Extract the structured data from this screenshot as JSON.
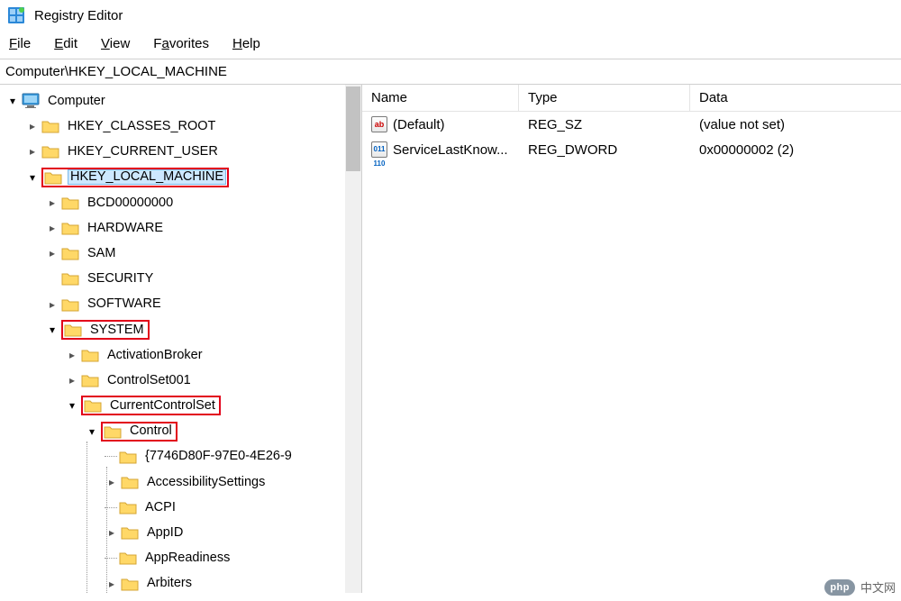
{
  "app": {
    "title": "Registry Editor"
  },
  "menu": {
    "file": "File",
    "edit": "Edit",
    "view": "View",
    "favorites": "Favorites",
    "help": "Help"
  },
  "address": {
    "path": "Computer\\HKEY_LOCAL_MACHINE"
  },
  "tree": {
    "root": "Computer",
    "hkcr": "HKEY_CLASSES_ROOT",
    "hkcu": "HKEY_CURRENT_USER",
    "hklm": "HKEY_LOCAL_MACHINE",
    "bcd": "BCD00000000",
    "hardware": "HARDWARE",
    "sam": "SAM",
    "security": "SECURITY",
    "software": "SOFTWARE",
    "system": "SYSTEM",
    "activationbroker": "ActivationBroker",
    "controlset001": "ControlSet001",
    "currentcontrolset": "CurrentControlSet",
    "control": "Control",
    "guid": "{7746D80F-97E0-4E26-9",
    "accessibility": "AccessibilitySettings",
    "acpi": "ACPI",
    "appid": "AppID",
    "appreadiness": "AppReadiness",
    "arbiters": "Arbiters"
  },
  "columns": {
    "name": "Name",
    "type": "Type",
    "data": "Data"
  },
  "values": [
    {
      "icon": "ab",
      "name": "(Default)",
      "type": "REG_SZ",
      "data": "(value not set)"
    },
    {
      "icon": "bin",
      "name": "ServiceLastKnow...",
      "type": "REG_DWORD",
      "data": "0x00000002 (2)"
    }
  ],
  "watermark": {
    "badge": "php",
    "text": "中文网"
  }
}
